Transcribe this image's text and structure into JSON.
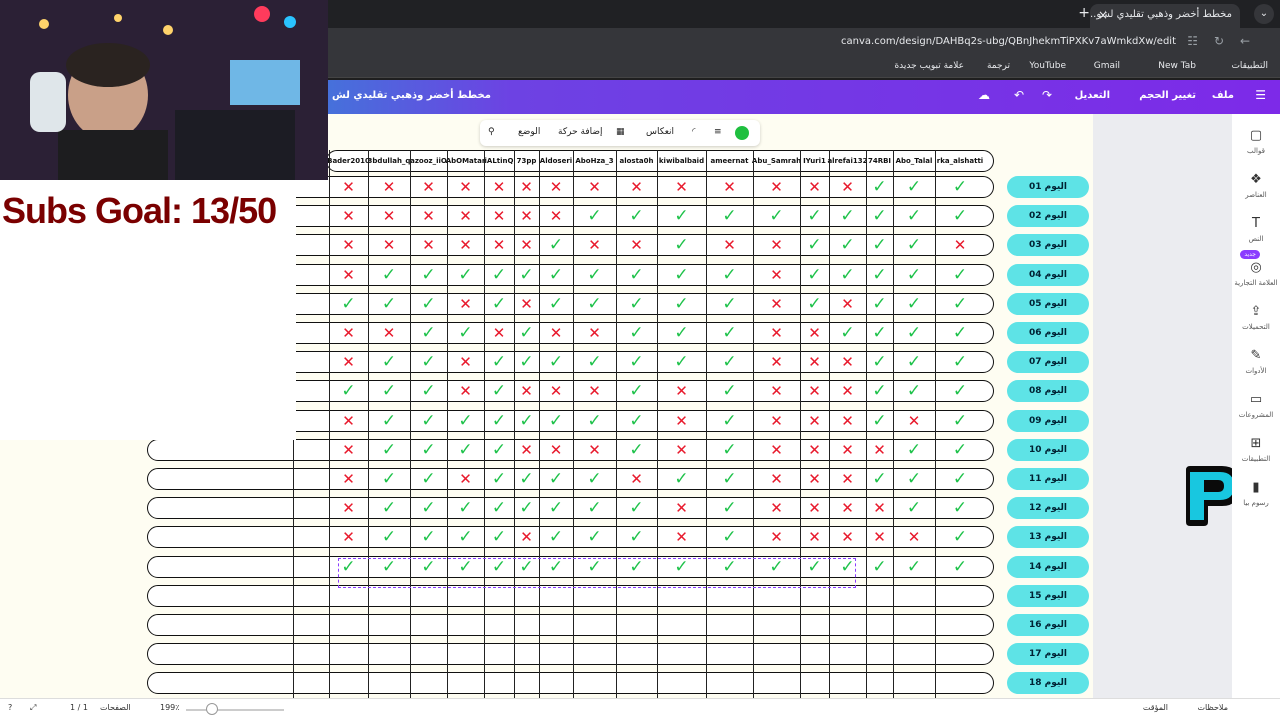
{
  "browser": {
    "tab_title": "مخطط أخضر وذهبي تقليدي لشو...",
    "tab_close": "×",
    "new_tab": "+",
    "menu": "⌄",
    "url": "canva.com/design/DAHBq2s-ubg/QBnJhekmTiPXKv7aWmkdXw/edit",
    "bookmarks": [
      "التطبيقات",
      "New Tab",
      "Gmail",
      "YouTube",
      "ترجمة",
      "علامة تبويب جديدة"
    ]
  },
  "canva_header": {
    "file": "ملف",
    "resize": "تغيير الحجم",
    "edit": "التعديل",
    "doc_title": "مخطط أخضر وذهبي تقليدي لش"
  },
  "toolbar": {
    "position": "الوضع",
    "add_animation": "إضافة حركة",
    "reflection": "انعكاس",
    "color": "#1fbf3f"
  },
  "sidebar": {
    "items": [
      {
        "label": "قوالب",
        "icon": "templates-icon",
        "glyph": "▢"
      },
      {
        "label": "العناصر",
        "icon": "elements-icon",
        "glyph": "❖"
      },
      {
        "label": "النص",
        "icon": "text-icon",
        "glyph": "T"
      },
      {
        "label": "العلامة التجارية",
        "icon": "brand-icon",
        "glyph": "◎"
      },
      {
        "label": "التحميلات",
        "icon": "upload-icon",
        "glyph": "⇪"
      },
      {
        "label": "الأدوات",
        "icon": "tools-icon",
        "glyph": "✎"
      },
      {
        "label": "المشروعات",
        "icon": "folder-icon",
        "glyph": "▭"
      },
      {
        "label": "التطبيقات",
        "icon": "apps-icon",
        "glyph": "⊞"
      },
      {
        "label": "رسوم بيا",
        "icon": "chart-icon",
        "glyph": "▮"
      }
    ],
    "new_badge": "جديد"
  },
  "overlay": {
    "subs_goal": "Subs Goal: 13/50"
  },
  "tracker": {
    "names": [
      "Bader2010",
      "3bdullah_q",
      "azooz_iiO",
      "AbOMatar",
      "iALtinQ",
      "73pp",
      "Aldoseri",
      "AboHza_3",
      "alosta0h",
      "kiwibalbaid",
      "ameernat",
      "Abu_Samrah",
      "IYuri1",
      "alrefai132",
      "74RBI",
      "Abo_Talal",
      "rka_alshatti"
    ],
    "days": [
      "اليوم 01",
      "اليوم 02",
      "اليوم 03",
      "اليوم 04",
      "اليوم 05",
      "اليوم 06",
      "اليوم 07",
      "اليوم 08",
      "اليوم 09",
      "اليوم 10",
      "اليوم 11",
      "اليوم 12",
      "اليوم 13",
      "اليوم 14",
      "اليوم 15",
      "اليوم 16",
      "اليوم 17",
      "اليوم 18"
    ],
    "marks": [
      [
        "x",
        "x",
        "x",
        "x",
        "x",
        "x",
        "x",
        "x",
        "x",
        "x",
        "x",
        "x",
        "x",
        "x",
        "y",
        "y",
        "y"
      ],
      [
        "x",
        "x",
        "x",
        "x",
        "x",
        "x",
        "x",
        "y",
        "y",
        "y",
        "y",
        "y",
        "y",
        "y",
        "y",
        "y",
        "y"
      ],
      [
        "x",
        "x",
        "x",
        "x",
        "x",
        "x",
        "y",
        "x",
        "x",
        "y",
        "x",
        "x",
        "y",
        "y",
        "y",
        "y",
        "x"
      ],
      [
        "x",
        "y",
        "y",
        "y",
        "y",
        "y",
        "y",
        "y",
        "y",
        "y",
        "y",
        "x",
        "y",
        "y",
        "y",
        "y",
        "y"
      ],
      [
        "y",
        "y",
        "y",
        "x",
        "y",
        "x",
        "y",
        "y",
        "y",
        "y",
        "y",
        "x",
        "y",
        "x",
        "y",
        "y",
        "y"
      ],
      [
        "x",
        "x",
        "y",
        "y",
        "x",
        "y",
        "x",
        "x",
        "y",
        "y",
        "y",
        "x",
        "x",
        "y",
        "y",
        "y",
        "y"
      ],
      [
        "x",
        "y",
        "y",
        "x",
        "y",
        "y",
        "y",
        "y",
        "y",
        "y",
        "y",
        "x",
        "x",
        "x",
        "y",
        "y",
        "y"
      ],
      [
        "y",
        "y",
        "y",
        "x",
        "y",
        "x",
        "x",
        "x",
        "y",
        "x",
        "y",
        "x",
        "x",
        "x",
        "y",
        "y",
        "y"
      ],
      [
        "x",
        "y",
        "y",
        "y",
        "y",
        "y",
        "y",
        "y",
        "y",
        "x",
        "y",
        "x",
        "x",
        "x",
        "y",
        "x",
        "y"
      ],
      [
        "x",
        "y",
        "y",
        "y",
        "y",
        "x",
        "x",
        "x",
        "y",
        "x",
        "y",
        "x",
        "x",
        "x",
        "x",
        "y",
        "y"
      ],
      [
        "x",
        "y",
        "y",
        "x",
        "y",
        "y",
        "y",
        "y",
        "x",
        "y",
        "y",
        "x",
        "x",
        "x",
        "y",
        "y",
        "y"
      ],
      [
        "x",
        "y",
        "y",
        "y",
        "y",
        "y",
        "y",
        "y",
        "y",
        "x",
        "y",
        "x",
        "x",
        "x",
        "x",
        "y",
        "y"
      ],
      [
        "x",
        "y",
        "y",
        "y",
        "y",
        "x",
        "y",
        "y",
        "y",
        "x",
        "y",
        "x",
        "x",
        "x",
        "x",
        "x",
        "y"
      ],
      [
        "y",
        "y",
        "y",
        "y",
        "y",
        "y",
        "y",
        "y",
        "y",
        "y",
        "y",
        "y",
        "y",
        "y",
        "y",
        "y",
        "y"
      ],
      [],
      [],
      [],
      []
    ]
  },
  "bottom": {
    "notes": "ملاحظات",
    "timer": "المؤقت",
    "pages": "الصفحات",
    "page_count": "1 / 1",
    "zoom": "199٪"
  }
}
